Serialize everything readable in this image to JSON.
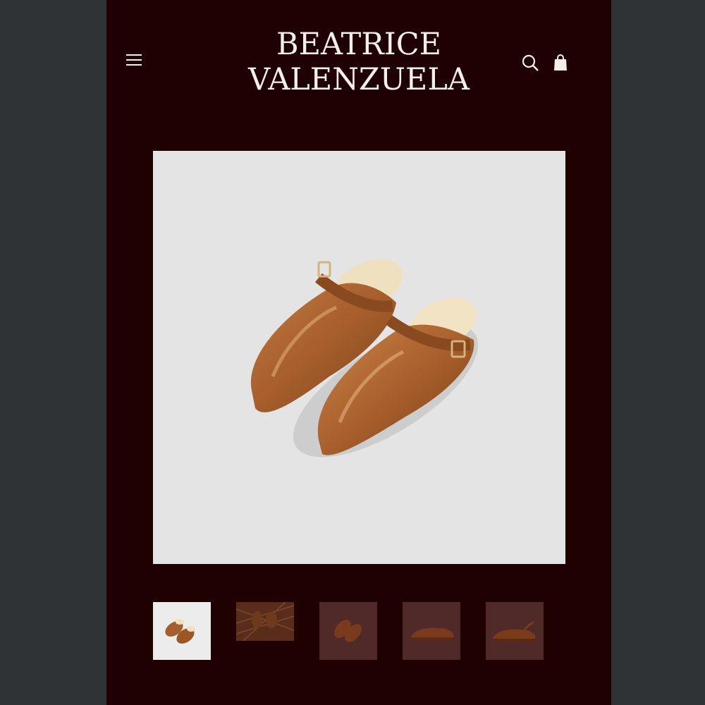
{
  "header": {
    "brand_line1": "BEATRICE",
    "brand_line2": "VALENZUELA",
    "icons": {
      "menu": "hamburger-icon",
      "search": "search-icon",
      "bag": "shopping-bag-icon"
    }
  },
  "product": {
    "main_image": "product-photo-brown-leather-shearling-clogs",
    "thumbnails": [
      {
        "name": "thumb-clogs-pair-front",
        "active": true
      },
      {
        "name": "thumb-clogs-on-straw",
        "active": false
      },
      {
        "name": "thumb-clogs-pair-top",
        "active": false
      },
      {
        "name": "thumb-clog-side-view",
        "active": false
      },
      {
        "name": "thumb-clog-side-strap-back",
        "active": false
      }
    ]
  },
  "colors": {
    "page_background": "#303336",
    "panel_background": "#200102",
    "brand_text": "#f4efe9",
    "image_background": "#e4e4e4",
    "leather": "#a55e2c"
  }
}
